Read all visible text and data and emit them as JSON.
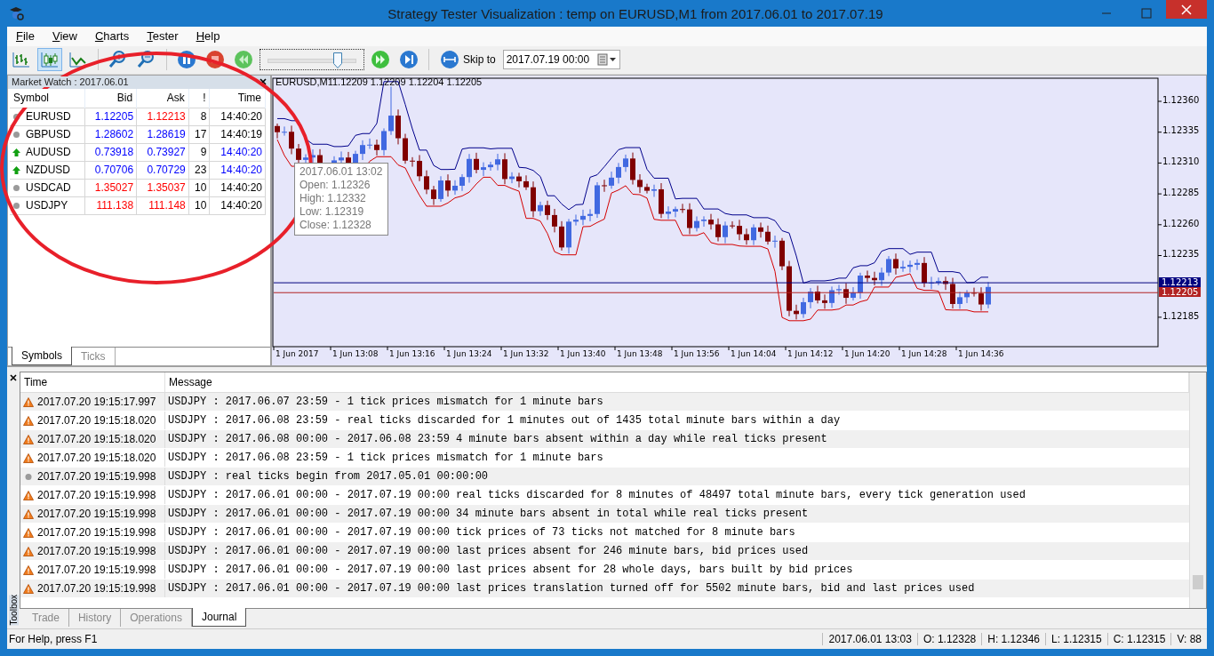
{
  "window": {
    "title": "Strategy Tester Visualization : temp on EURUSD,M1 from 2017.06.01 to 2017.07.19"
  },
  "menu": [
    "File",
    "View",
    "Charts",
    "Tester",
    "Help"
  ],
  "toolbar": {
    "chart_modes": [
      {
        "kind": "bars",
        "selected": false
      },
      {
        "kind": "candles",
        "selected": true
      },
      {
        "kind": "line",
        "selected": false
      }
    ],
    "speed": {
      "level": 0.8
    },
    "skip_button": "Skip to",
    "skip_date": "2017.07.19 00:00"
  },
  "market_watch": {
    "title": "Market Watch : 2017.06.01",
    "columns": [
      "Symbol",
      "Bid",
      "Ask",
      "!",
      "Time"
    ],
    "rows": [
      {
        "rising": false,
        "symbol": "EURUSD",
        "bid": "1.12205",
        "bid_up": true,
        "ask": "1.12213",
        "ask_up": false,
        "spread": "8",
        "time": "14:40:20",
        "fresh": false
      },
      {
        "rising": false,
        "symbol": "GBPUSD",
        "bid": "1.28602",
        "bid_up": true,
        "ask": "1.28619",
        "ask_up": true,
        "spread": "17",
        "time": "14:40:19",
        "fresh": false
      },
      {
        "rising": true,
        "symbol": "AUDUSD",
        "bid": "0.73918",
        "bid_up": true,
        "ask": "0.73927",
        "ask_up": true,
        "spread": "9",
        "time": "14:40:20",
        "fresh": true
      },
      {
        "rising": true,
        "symbol": "NZDUSD",
        "bid": "0.70706",
        "bid_up": true,
        "ask": "0.70729",
        "ask_up": true,
        "spread": "23",
        "time": "14:40:20",
        "fresh": true
      },
      {
        "rising": false,
        "symbol": "USDCAD",
        "bid": "1.35027",
        "bid_up": false,
        "ask": "1.35037",
        "ask_up": false,
        "spread": "10",
        "time": "14:40:20",
        "fresh": false
      },
      {
        "rising": false,
        "symbol": "USDJPY",
        "bid": "111.138",
        "bid_up": false,
        "ask": "111.148",
        "ask_up": false,
        "spread": "10",
        "time": "14:40:20",
        "fresh": false
      }
    ],
    "tabs": [
      {
        "label": "Symbols",
        "selected": true
      },
      {
        "label": "Ticks",
        "selected": false
      }
    ]
  },
  "chart": {
    "symbol": "EURUSD,M1",
    "ohlc": "1.12209 1.12209 1.12204 1.12205",
    "tooltip": [
      "2017.06.01 13:02",
      "Open: 1.12326",
      "High: 1.12332",
      "Low: 1.12319",
      "Close: 1.12328"
    ],
    "y_ticks": [
      "1.12360",
      "1.12335",
      "1.12310",
      "1.12285",
      "1.12260",
      "1.12235",
      "1.12185"
    ],
    "price_labels": [
      {
        "kind": "ask",
        "text": "1.12213"
      },
      {
        "kind": "bid",
        "text": "1.12205"
      }
    ],
    "x_ticks": [
      "1 Jun 2017",
      "1 Jun 13:08",
      "1 Jun 13:16",
      "1 Jun 13:24",
      "1 Jun 13:32",
      "1 Jun 13:40",
      "1 Jun 13:48",
      "1 Jun 13:56",
      "1 Jun 14:04",
      "1 Jun 14:12",
      "1 Jun 14:20",
      "1 Jun 14:28",
      "1 Jun 14:36"
    ]
  },
  "toolbox": {
    "label": "Toolbox",
    "columns": [
      "Time",
      "Message"
    ],
    "rows": [
      {
        "warning": true,
        "time": "2017.07.20 19:15:17.997",
        "message": "USDJPY : 2017.06.07 23:59 - 1 tick prices mismatch for 1 minute bars"
      },
      {
        "warning": true,
        "time": "2017.07.20 19:15:18.020",
        "message": "USDJPY : 2017.06.08 23:59 - real ticks discarded for 1 minutes out of 1435 total minute bars within a day"
      },
      {
        "warning": true,
        "time": "2017.07.20 19:15:18.020",
        "message": "USDJPY : 2017.06.08 00:00 - 2017.06.08 23:59  4 minute bars absent within a day while real ticks present"
      },
      {
        "warning": true,
        "time": "2017.07.20 19:15:18.020",
        "message": "USDJPY : 2017.06.08 23:59 - 1 tick prices mismatch for 1 minute bars"
      },
      {
        "warning": false,
        "time": "2017.07.20 19:15:19.998",
        "message": "USDJPY : real ticks begin from 2017.05.01 00:00:00"
      },
      {
        "warning": true,
        "time": "2017.07.20 19:15:19.998",
        "message": "USDJPY : 2017.06.01 00:00 - 2017.07.19 00:00  real ticks discarded for 8 minutes of 48497 total minute bars, every tick generation used"
      },
      {
        "warning": true,
        "time": "2017.07.20 19:15:19.998",
        "message": "USDJPY : 2017.06.01 00:00 - 2017.07.19 00:00  34 minute bars absent in total while real ticks present"
      },
      {
        "warning": true,
        "time": "2017.07.20 19:15:19.998",
        "message": "USDJPY : 2017.06.01 00:00 - 2017.07.19 00:00  tick prices of 73 ticks not matched for 8 minute bars"
      },
      {
        "warning": true,
        "time": "2017.07.20 19:15:19.998",
        "message": "USDJPY : 2017.06.01 00:00 - 2017.07.19 00:00  last prices absent for 246 minute bars, bid prices used"
      },
      {
        "warning": true,
        "time": "2017.07.20 19:15:19.998",
        "message": "USDJPY : 2017.06.01 00:00 - 2017.07.19 00:00  last prices absent for 28 whole days, bars built by bid prices"
      },
      {
        "warning": true,
        "time": "2017.07.20 19:15:19.998",
        "message": "USDJPY : 2017.06.01 00:00 - 2017.07.19 00:00  last prices translation turned off for 5502 minute bars, bid and last prices used"
      }
    ],
    "tabs": [
      {
        "label": "Trade",
        "selected": false
      },
      {
        "label": "History",
        "selected": false
      },
      {
        "label": "Operations",
        "selected": false
      },
      {
        "label": "Journal",
        "selected": true
      }
    ]
  },
  "status_bar": {
    "help": "For Help, press F1",
    "fields": [
      "2017.06.01 13:03",
      "O: 1.12328",
      "H: 1.12346",
      "L: 1.12315",
      "C: 1.12315",
      "V: 88"
    ]
  }
}
